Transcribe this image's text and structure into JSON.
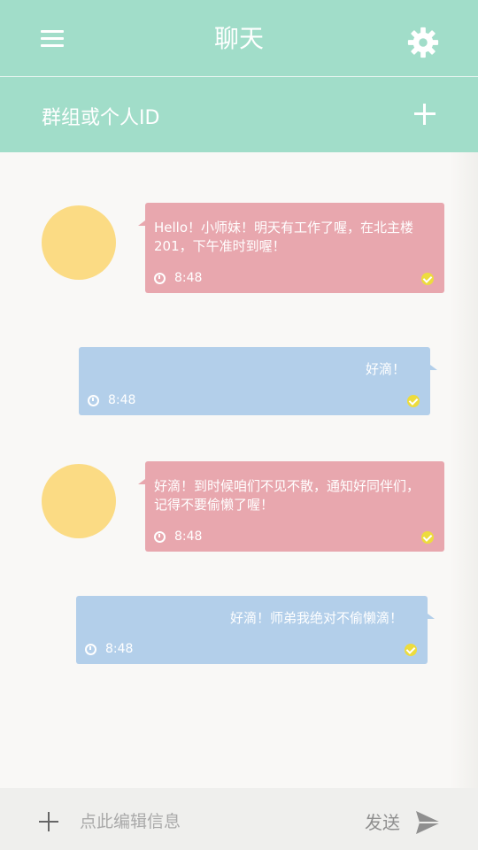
{
  "header": {
    "title": "聊天",
    "menu_icon": "hamburger-menu-icon",
    "settings_icon": "gear-icon"
  },
  "id_bar": {
    "label": "群组或个人ID",
    "add_icon": "plus-icon"
  },
  "messages": [
    {
      "side": "left",
      "text": "Hello！小师妹！明天有工作了喔，在北主楼201，下午准时到喔！",
      "time": "8:48",
      "status_icon": "check-circle-icon"
    },
    {
      "side": "right",
      "text": "好滴！",
      "time": "8:48",
      "status_icon": "check-circle-icon"
    },
    {
      "side": "left",
      "text": "好滴！到时候咱们不见不散，通知好同伴们，记得不要偷懒了喔！",
      "time": "8:48",
      "status_icon": "check-circle-icon"
    },
    {
      "side": "right",
      "text": "好滴！师弟我绝对不偷懒滴！",
      "time": "8:48",
      "status_icon": "check-circle-icon"
    }
  ],
  "composer": {
    "placeholder": "点此编辑信息",
    "value": "",
    "send_label": "发送",
    "send_icon": "paper-plane-icon",
    "attach_icon": "plus-icon"
  },
  "colors": {
    "header": "#a1ddc9",
    "incoming_bubble": "#e8a7ae",
    "outgoing_bubble": "#b3cfea",
    "avatar": "#fbdb84",
    "read_check": "#eddc3d"
  }
}
